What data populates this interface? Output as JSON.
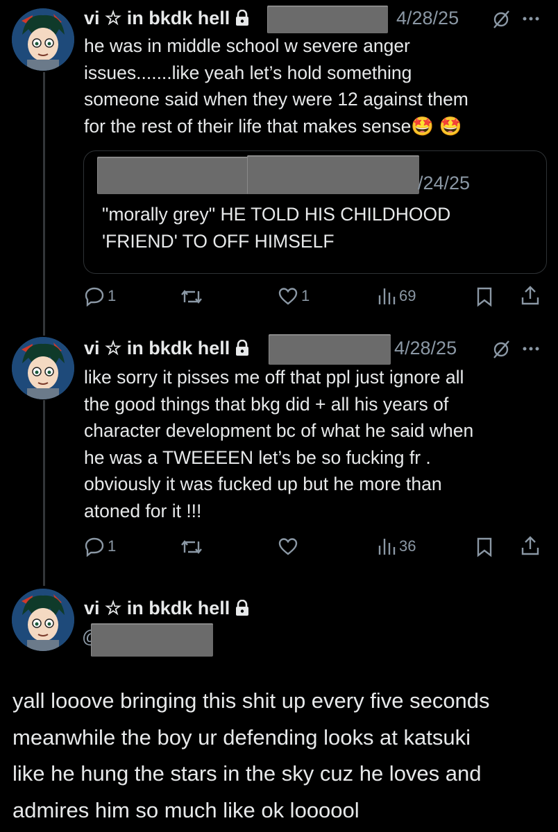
{
  "posts": [
    {
      "author": "vi ☆ in bkdk hell",
      "date": "4/28/25",
      "body": [
        "he was in middle school w severe anger",
        "issues.......like yeah let’s hold something",
        "someone said when they were 12 against them",
        "for the rest of their life that makes sense🤩 🤩"
      ],
      "quote": {
        "date": "/24/25",
        "body": [
          "\"morally grey\" HE TOLD HIS CHILDHOOD",
          "'FRIEND' TO OFF HIMSELF"
        ]
      },
      "actions": {
        "replies": "1",
        "reposts": "",
        "likes": "1",
        "views": "69"
      }
    },
    {
      "author": "vi ☆ in bkdk hell",
      "date": "4/28/25",
      "body": [
        "like sorry it pisses me off that ppl just ignore all",
        "the good things that bkg did + all his years of",
        "character development bc of what he said when",
        "he was a TWEEEEN let’s be so fucking fr .",
        "obviously it was fucked up but he more than",
        "atoned for it !!!"
      ],
      "actions": {
        "replies": "1",
        "reposts": "",
        "likes": "",
        "views": "36"
      }
    }
  ],
  "main_post": {
    "author": "vi ☆ in bkdk hell",
    "handle_prefix": "@",
    "body": [
      "yall looove bringing this shit up every five seconds",
      "meanwhile the boy ur defending looks at katsuki",
      "like he hung the stars in the sky cuz he loves and",
      "admires him so much like ok loooool"
    ]
  },
  "colors": {
    "background": "#000000",
    "text": "#e7e9ea",
    "muted": "#8b98a5",
    "redaction": "#6b6b6b"
  }
}
